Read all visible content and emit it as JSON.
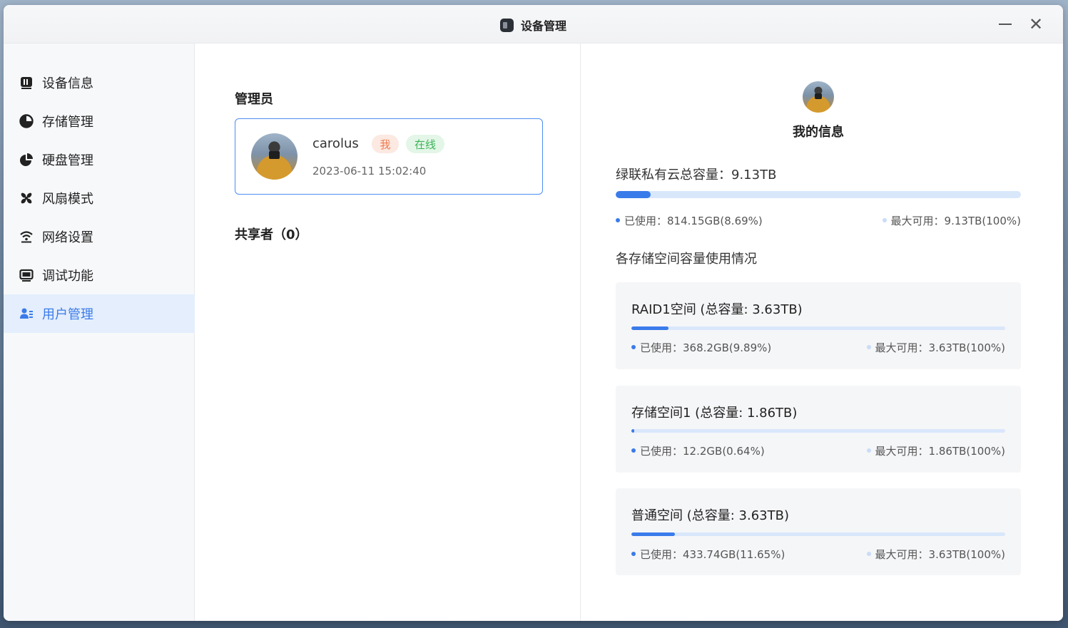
{
  "window": {
    "title": "设备管理"
  },
  "sidebar": {
    "items": [
      {
        "label": "设备信息",
        "icon": "device-icon",
        "active": false
      },
      {
        "label": "存储管理",
        "icon": "pie-chart-icon",
        "active": false
      },
      {
        "label": "硬盘管理",
        "icon": "disk-icon",
        "active": false
      },
      {
        "label": "风扇模式",
        "icon": "fan-icon",
        "active": false
      },
      {
        "label": "网络设置",
        "icon": "wifi-icon",
        "active": false
      },
      {
        "label": "调试功能",
        "icon": "monitor-icon",
        "active": false
      },
      {
        "label": "用户管理",
        "icon": "users-icon",
        "active": true
      }
    ]
  },
  "users": {
    "admin_heading": "管理员",
    "admin": {
      "name": "carolus",
      "tag_me": "我",
      "tag_online": "在线",
      "time": "2023-06-11 15:02:40"
    },
    "sharers_heading": "共享者（0）"
  },
  "my_info": {
    "title": "我的信息",
    "total_label": "绿联私有云总容量：9.13TB",
    "used_label": "已使用：814.15GB(8.69%)",
    "max_label": "最大可用：9.13TB(100%)",
    "used_percent": 8.69,
    "spaces_heading": "各存储空间容量使用情况",
    "spaces": [
      {
        "title": "RAID1空间 (总容量: 3.63TB)",
        "used_label": "已使用：368.2GB(9.89%)",
        "max_label": "最大可用：3.63TB(100%)",
        "used_percent": 9.89
      },
      {
        "title": "存储空间1 (总容量: 1.86TB)",
        "used_label": "已使用：12.2GB(0.64%)",
        "max_label": "最大可用：1.86TB(100%)",
        "used_percent": 0.64
      },
      {
        "title": "普通空间 (总容量: 3.63TB)",
        "used_label": "已使用：433.74GB(11.65%)",
        "max_label": "最大可用：3.63TB(100%)",
        "used_percent": 11.65
      }
    ]
  },
  "colors": {
    "accent": "#3a7bea",
    "active_bg": "#e4eefc",
    "bar_track": "#d9e7fb"
  }
}
